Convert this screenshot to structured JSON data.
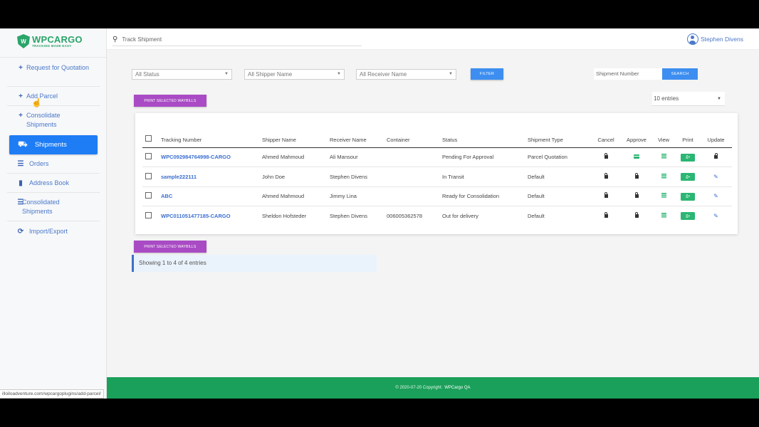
{
  "brand": {
    "name": "WPCARGO",
    "tagline": "TRACKING MADE EASY",
    "logo_letter": "W"
  },
  "topbar": {
    "search_placeholder": "Track Shipment",
    "user_name": "Stephen Divens"
  },
  "sidebar": {
    "request_quotation": "Request for Quotation",
    "add_parcel": "Add Parcel",
    "consolidate_shipments": "Consolidate Shipments",
    "shipments": "Shipments",
    "orders": "Orders",
    "address_book": "Address Book",
    "consolidated_shipments": "Consolidated Shipments",
    "import_export": "Import/Export"
  },
  "filters": {
    "status": "All Status",
    "shipper": "All Shipper Name",
    "receiver": "All Receiver Name",
    "filter_button": "FILTER",
    "shipment_number_placeholder": "Shipment Number",
    "search_button": "SEARCH"
  },
  "print_waybills": "PRINT SELECTED WAYBILLS",
  "entries": "10 entries",
  "table": {
    "headers": {
      "tracking": "Tracking Number",
      "shipper": "Shipper Name",
      "receiver": "Receiver Name",
      "container": "Container",
      "status": "Status",
      "type": "Shipment Type",
      "cancel": "Cancel",
      "approve": "Approve",
      "view": "View",
      "print": "Print",
      "update": "Update"
    },
    "rows": [
      {
        "tracking": "WPC092984764998-CARGO",
        "shipper": "Ahmed Mahmoud",
        "receiver": "Ali Mansour",
        "container": "",
        "status": "Pending For Approval",
        "type": "Parcel Quotation"
      },
      {
        "tracking": "sample222111",
        "shipper": "John Doe",
        "receiver": "Stephen Divens",
        "container": "",
        "status": "In Transit",
        "type": "Default"
      },
      {
        "tracking": "ABC",
        "shipper": "Ahmed Mahmoud",
        "receiver": "Jimmy Lina",
        "container": "",
        "status": "Ready for Consolidation",
        "type": "Default"
      },
      {
        "tracking": "WPC011051477185-CARGO",
        "shipper": "Sheldon Hofsteder",
        "receiver": "Stephen Divens",
        "container": "006005362578",
        "status": "Out for delivery",
        "type": "Default"
      }
    ]
  },
  "info_text": "Showing 1 to 4 of 4 entries",
  "footer": {
    "copyright": "© 2020-07-20 Copyright:",
    "site": "WPCargo QA"
  },
  "status_url": "illoiloadventure.com/wpcargoplugins/add-parcel/"
}
